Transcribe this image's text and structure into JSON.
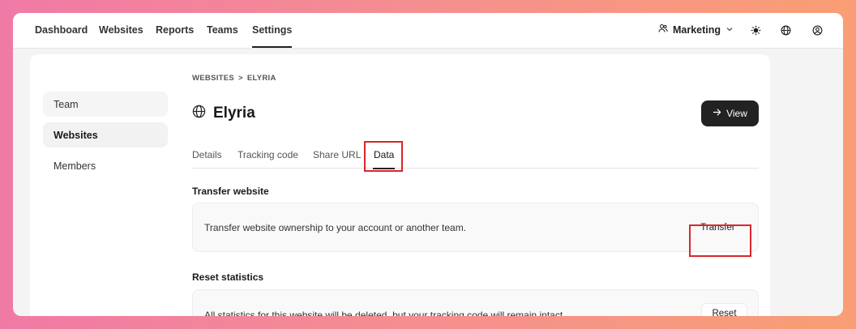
{
  "nav": {
    "items": [
      "Dashboard",
      "Websites",
      "Reports",
      "Teams",
      "Settings"
    ],
    "team_name": "Marketing"
  },
  "sidebar": {
    "items": [
      "Team",
      "Websites",
      "Members"
    ]
  },
  "breadcrumb": {
    "parent": "WEBSITES",
    "separator": ">",
    "current": "ELYRIA"
  },
  "page": {
    "title": "Elyria",
    "view_label": "View"
  },
  "tabs": [
    "Details",
    "Tracking code",
    "Share URL",
    "Data"
  ],
  "transfer": {
    "title": "Transfer website",
    "description": "Transfer website ownership to your account or another team.",
    "button": "Transfer"
  },
  "reset": {
    "title": "Reset statistics",
    "description": "All statistics for this website will be deleted, but your tracking code will remain intact.",
    "button": "Reset"
  },
  "colors": {
    "highlight": "#d9262a",
    "primary_button": "#222222"
  },
  "icons": [
    "team-icon",
    "chevron-down-icon",
    "sun-icon",
    "globe-icon",
    "user-icon",
    "arrow-right-icon"
  ]
}
